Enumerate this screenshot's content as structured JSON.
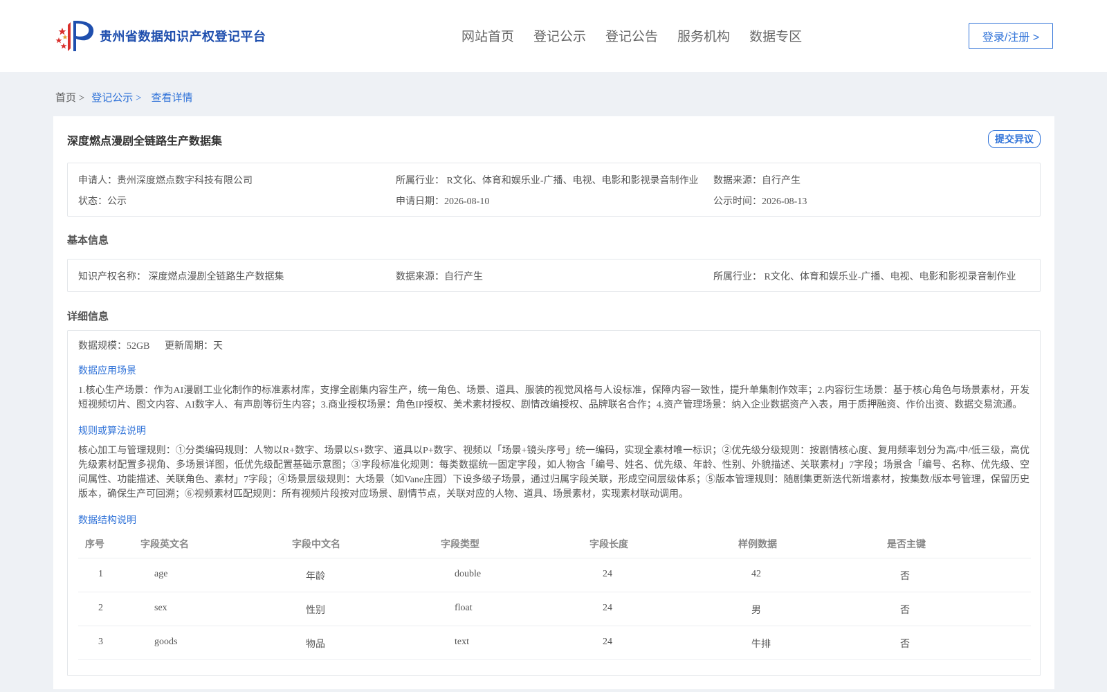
{
  "colors": {
    "accent": "#2f72d8",
    "brand": "#1f4fae",
    "background": "#eef1f5"
  },
  "header": {
    "site_title": "贵州省数据知识产权登记平台",
    "logo_icon": "stars-flag-logo-icon",
    "nav": [
      "网站首页",
      "登记公示",
      "登记公告",
      "服务机构",
      "数据专区"
    ],
    "login_label": "登录/注册 >"
  },
  "breadcrumb": {
    "home": "首页 >",
    "section": "登记公示 >",
    "current": "查看详情"
  },
  "detail": {
    "title": "深度燃点漫剧全链路生产数据集",
    "objection_label": "提交异议",
    "summary": {
      "applicant": "申请人：贵州深度燃点数字科技有限公司",
      "industry": "所属行业： R文化、体育和娱乐业-广播、电视、电影和影视录音制作业",
      "source": "数据来源：自行产生",
      "status": "状态：公示",
      "apply_date": "申请日期：2026-08-10",
      "publish_date": "公示时间：2026-08-13"
    },
    "basic_title": "基本信息",
    "basic": {
      "ip_name": "知识产权名称： 深度燃点漫剧全链路生产数据集",
      "source": "数据来源：自行产生",
      "industry": "所属行业： R文化、体育和娱乐业-广播、电视、电影和影视录音制作业"
    },
    "detail_title": "详细信息",
    "scale": "数据规模：52GB",
    "update_cycle": "更新周期：天",
    "scenario_title": "数据应用场景",
    "scenario_text": "1.核心生产场景：作为AI漫剧工业化制作的标准素材库，支撑全剧集内容生产，统一角色、场景、道具、服装的视觉风格与人设标准，保障内容一致性，提升单集制作效率；2.内容衍生场景：基于核心角色与场景素材，开发短视频切片、图文内容、AI数字人、有声剧等衍生内容；3.商业授权场景：角色IP授权、美术素材授权、剧情改编授权、品牌联名合作；4.资产管理场景：纳入企业数据资产入表，用于质押融资、作价出资、数据交易流通。",
    "rules_title": "规则或算法说明",
    "rules_text": "核心加工与管理规则：①分类编码规则：人物以R+数字、场景以S+数字、道具以P+数字、视频以「场景+镜头序号」统一编码，实现全素材唯一标识；②优先级分级规则：按剧情核心度、复用频率划分为高/中/低三级，高优先级素材配置多视角、多场景详图，低优先级配置基础示意图；③字段标准化规则：每类数据统一固定字段，如人物含「编号、姓名、优先级、年龄、性别、外貌描述、关联素材」7字段；场景含「编号、名称、优先级、空间属性、功能描述、关联角色、素材」7字段；④场景层级规则：大场景（如Vane庄园）下设多级子场景，通过归属字段关联，形成空间层级体系；⑤版本管理规则：随剧集更新迭代新增素材，按集数/版本号管理，保留历史版本，确保生产可回溯；⑥视频素材匹配规则：所有视频片段按对应场景、剧情节点，关联对应的人物、道具、场景素材，实现素材联动调用。",
    "structure_title": "数据结构说明",
    "table": {
      "headers": [
        "序号",
        "字段英文名",
        "字段中文名",
        "字段类型",
        "字段长度",
        "样例数据",
        "是否主键"
      ],
      "rows": [
        [
          "1",
          "age",
          "年龄",
          "double",
          "24",
          "42",
          "否"
        ],
        [
          "2",
          "sex",
          "性别",
          "float",
          "24",
          "男",
          "否"
        ],
        [
          "3",
          "goods",
          "物品",
          "text",
          "24",
          "牛排",
          "否"
        ]
      ]
    }
  }
}
